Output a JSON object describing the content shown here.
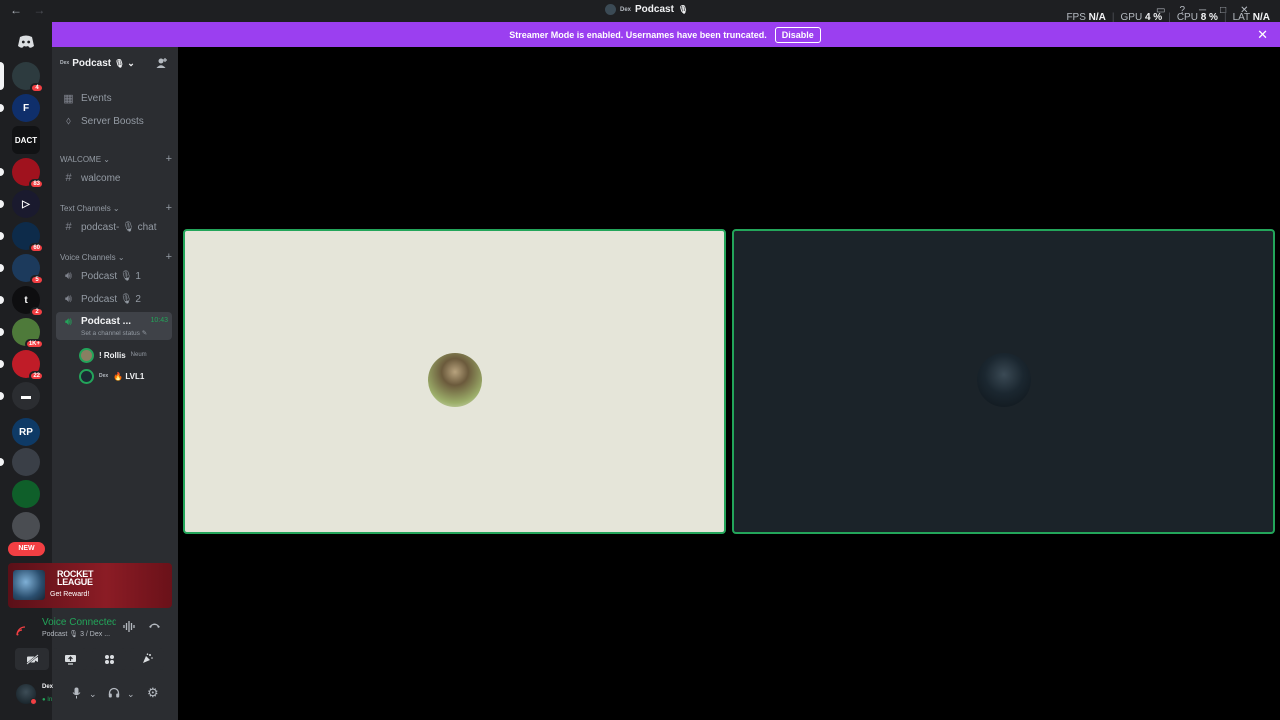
{
  "titlebar": {
    "back": "←",
    "forward": "→",
    "user_tag": "Dex",
    "server_name": "Podcast",
    "mic_glyph": "🎙"
  },
  "stats": {
    "fps_label": "FPS",
    "fps_value": "N/A",
    "gpu_label": "GPU",
    "gpu_value": "4 %",
    "cpu_label": "CPU",
    "cpu_value": "8 %",
    "lat_label": "LAT",
    "lat_value": "N/A"
  },
  "banner": {
    "message": "Streamer Mode is enabled. Usernames have been truncated.",
    "disable_label": "Disable",
    "close_glyph": "✕"
  },
  "server_rail": {
    "new_label": "NEW",
    "servers": [
      {
        "name": "Home",
        "glyph": "◕",
        "color": "#5865f2"
      },
      {
        "name": "Server 1",
        "glyph": "",
        "color": "#2d3b3f",
        "badge": "4"
      },
      {
        "name": "Server F",
        "glyph": "F",
        "color": "#0f2f6b"
      },
      {
        "name": "DACT",
        "glyph": "DACT",
        "color": "#111214"
      },
      {
        "name": "Server 83",
        "glyph": "",
        "color": "#a0121e",
        "badge": "83"
      },
      {
        "name": "Server Play",
        "glyph": "▷",
        "color": "#1a1a2e"
      },
      {
        "name": "Server 60",
        "glyph": "",
        "color": "#0d2b4a",
        "badge": "60"
      },
      {
        "name": "Server 5",
        "glyph": "",
        "color": "#1c3a5c",
        "badge": "5"
      },
      {
        "name": "Server t",
        "glyph": "t",
        "color": "#0e0e10",
        "badge": "2"
      },
      {
        "name": "Server 1K",
        "glyph": "",
        "color": "#4e7a3a",
        "badge": "1K+"
      },
      {
        "name": "Server 22",
        "glyph": "",
        "color": "#c01c28",
        "badge": "22"
      },
      {
        "name": "Folder",
        "glyph": "▬",
        "color": "#2b2d31"
      },
      {
        "name": "Server RP",
        "glyph": "RP",
        "color": "#0e3a66"
      },
      {
        "name": "Server Seal",
        "glyph": "",
        "color": "#3a3f47"
      },
      {
        "name": "Server V",
        "glyph": "",
        "color": "#0f5f2a"
      },
      {
        "name": "Server Black",
        "glyph": "",
        "color": "#4a4d52"
      }
    ]
  },
  "sidebar": {
    "header_tag": "Dex",
    "server_name": "Podcast",
    "server_glyph": "🎙",
    "chevron": "⌄",
    "invite_icon_glyph": "👤",
    "events_label": "Events",
    "boosts_label": "Server Boosts",
    "categories": {
      "welcome": "WALCOME",
      "text": "Text Channels",
      "voice": "Voice Channels"
    },
    "channels": {
      "welcome": "walcome",
      "text_chat": "podcast- 🎙 chat",
      "voice1": "Podcast 🎙 1",
      "voice2": "Podcast 🎙 2",
      "voice3": "Podcast ...",
      "voice3_time": "10:43",
      "voice3_status": "Set a channel status ✎"
    },
    "voice_users": [
      {
        "name": "! Rollis",
        "extra": "Neum",
        "avatar_color": "#8a7f62"
      },
      {
        "tag": "Dex",
        "name": "🔥 LVL1",
        "avatar_color": "#1b2a33"
      }
    ]
  },
  "promo": {
    "title": "ROCKET LEAGUE",
    "cta": "Get Reward!"
  },
  "voice_panel": {
    "title": "Voice Connected",
    "subtitle": "Podcast 🎙 3 / Dex ...",
    "signal_glyph": "📶",
    "buttons": [
      {
        "name": "camera-off-button",
        "glyph": "⌀"
      },
      {
        "name": "screen-share-button",
        "glyph": "▣"
      },
      {
        "name": "activity-button",
        "glyph": "✦"
      },
      {
        "name": "soundboard-button",
        "glyph": "♫"
      }
    ]
  },
  "user_panel": {
    "name": "Dex",
    "status": "● In",
    "mic_glyph": "🎤",
    "headset_glyph": "🎧",
    "settings_glyph": "⚙",
    "chevron": "⌄"
  },
  "stage": {
    "tiles": [
      {
        "name": "participant-tile-rollis",
        "bg": "#e5e5d9",
        "avatar": "#6b5a3c"
      },
      {
        "name": "participant-tile-dex",
        "bg": "#1b2329",
        "avatar": "#0e1419"
      }
    ]
  }
}
